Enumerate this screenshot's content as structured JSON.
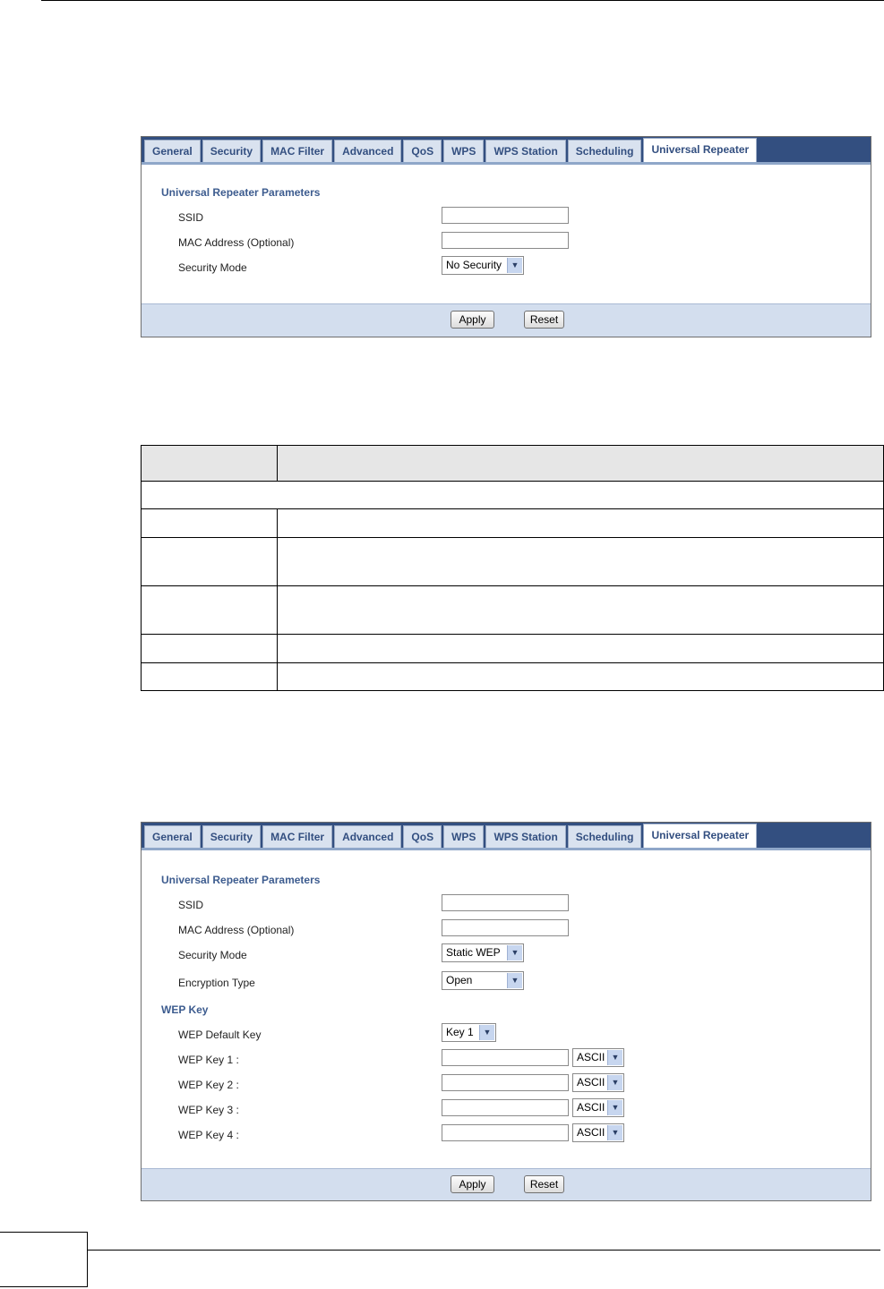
{
  "tabs": [
    "General",
    "Security",
    "MAC Filter",
    "Advanced",
    "QoS",
    "WPS",
    "WPS Station",
    "Scheduling",
    "Universal Repeater"
  ],
  "screen1": {
    "section_title": "Universal Repeater Parameters",
    "ssid_label": "SSID",
    "ssid_value": "",
    "mac_label": "MAC Address (Optional)",
    "mac_value": "",
    "security_mode_label": "Security Mode",
    "security_mode_value": "No Security",
    "apply_label": "Apply",
    "reset_label": "Reset"
  },
  "screen2": {
    "section_title": "Universal Repeater Parameters",
    "ssid_label": "SSID",
    "ssid_value": "",
    "mac_label": "MAC Address (Optional)",
    "mac_value": "",
    "security_mode_label": "Security Mode",
    "security_mode_value": "Static WEP",
    "encryption_label": "Encryption Type",
    "encryption_value": "Open",
    "wep_section_title": "WEP Key",
    "wep_default_label": "WEP Default Key",
    "wep_default_value": "Key 1",
    "wep_keys": [
      {
        "label": "WEP Key 1 :",
        "value": "",
        "format": "ASCII"
      },
      {
        "label": "WEP Key 2 :",
        "value": "",
        "format": "ASCII"
      },
      {
        "label": "WEP Key 3 :",
        "value": "",
        "format": "ASCII"
      },
      {
        "label": "WEP Key 4 :",
        "value": "",
        "format": "ASCII"
      }
    ],
    "apply_label": "Apply",
    "reset_label": "Reset"
  },
  "colors": {
    "tab_bar": "#334f80",
    "tab_text": "#334f80",
    "section_title": "#3d5c8f",
    "footer_bar": "#d3deee",
    "table_header": "#e6e6e6"
  },
  "icons": {
    "dropdown_arrow": "chevron-down-icon"
  }
}
